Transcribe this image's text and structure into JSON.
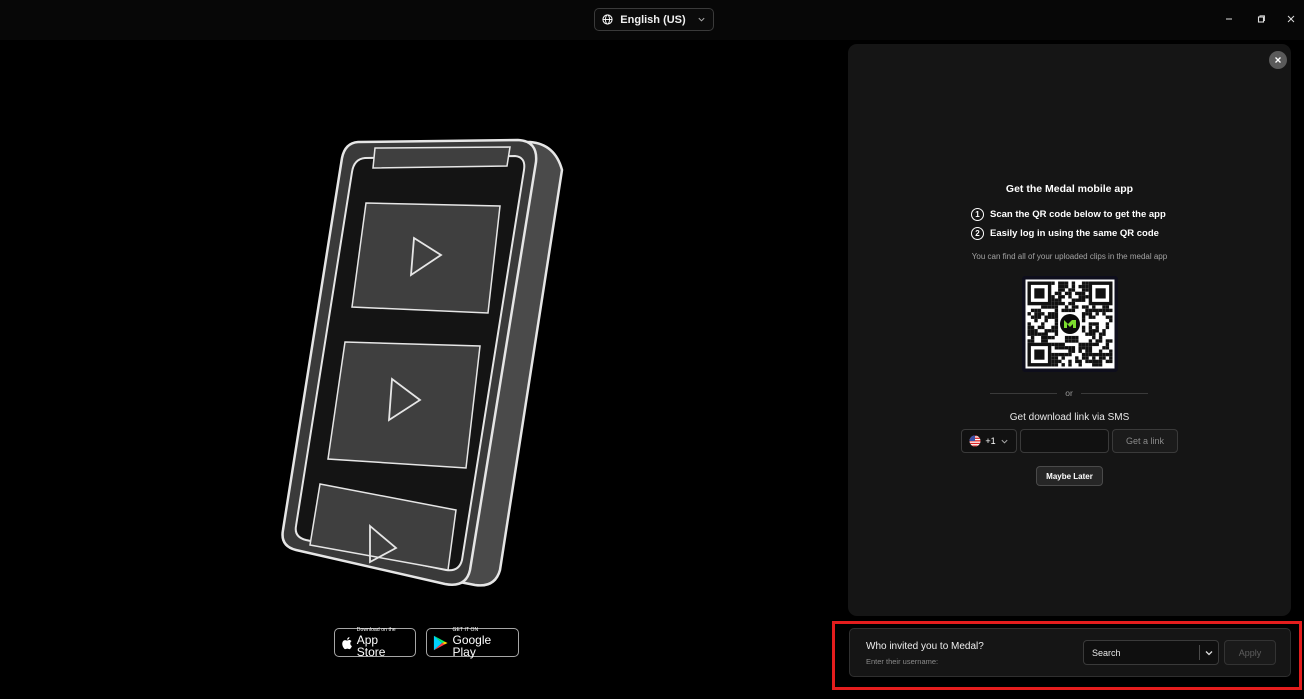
{
  "topbar": {
    "language": "English (US)",
    "window_controls": [
      "minimize-icon",
      "restore-icon",
      "close-icon"
    ]
  },
  "stores": {
    "app_store": {
      "small": "Download on the",
      "big": "App Store"
    },
    "google_play": {
      "small": "GET IT ON",
      "big": "Google Play"
    }
  },
  "panel": {
    "title": "Get the Medal mobile app",
    "steps": [
      {
        "num": "1",
        "text": "Scan the QR code below to get the app"
      },
      {
        "num": "2",
        "text": "Easily log in using the same QR code"
      }
    ],
    "hint": "You can find all of your uploaded clips in the medal app",
    "or": "or",
    "sms_label": "Get download link via SMS",
    "country_code": "+1",
    "phone_value": "",
    "get_link": "Get a link",
    "maybe_later": "Maybe Later"
  },
  "invite": {
    "title": "Who invited you to Medal?",
    "subtitle": "Enter their username:",
    "search_value": "Search",
    "apply": "Apply"
  },
  "colors": {
    "background": "#000000",
    "panel": "#151515",
    "highlight": "#e41d1d",
    "medal_green": "#7cdc2e"
  }
}
